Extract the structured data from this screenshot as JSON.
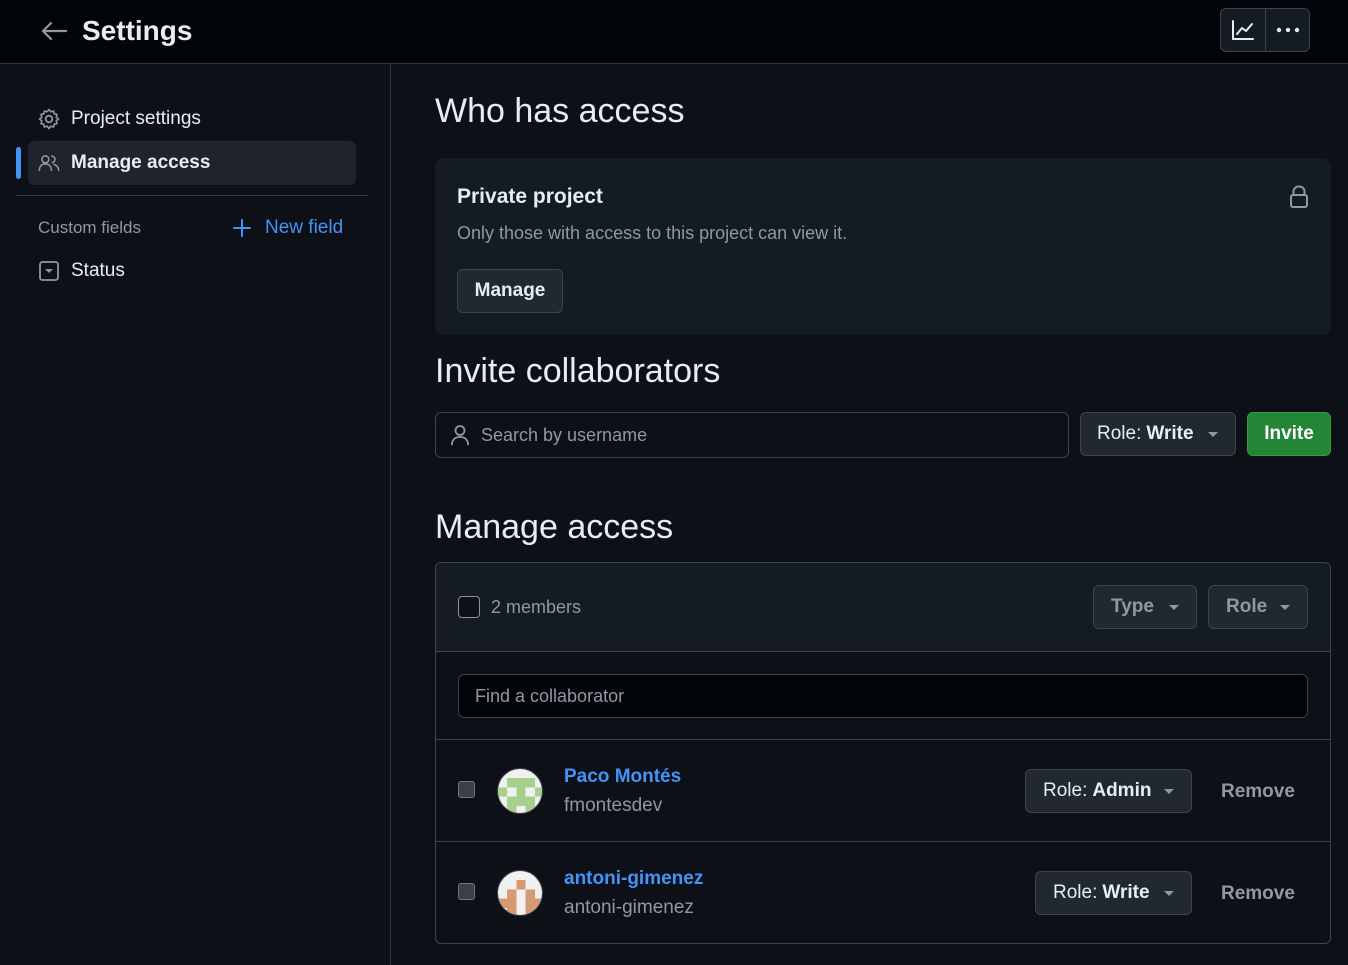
{
  "header": {
    "title": "Settings"
  },
  "sidebar": {
    "items": [
      {
        "label": "Project settings",
        "icon": "gear-icon"
      },
      {
        "label": "Manage access",
        "icon": "people-icon",
        "active": true
      }
    ],
    "custom_fields_label": "Custom fields",
    "new_field_label": "New field",
    "fields": [
      {
        "label": "Status",
        "icon": "single-select-icon"
      }
    ]
  },
  "who_has_access": {
    "heading": "Who has access",
    "card_title": "Private project",
    "card_description": "Only those with access to this project can view it.",
    "manage_label": "Manage"
  },
  "invite": {
    "heading": "Invite collaborators",
    "search_placeholder": "Search by username",
    "role_key": "Role:",
    "role_value": "Write",
    "invite_label": "Invite"
  },
  "manage_access": {
    "heading": "Manage access",
    "members_count": "2 members",
    "type_filter": "Type",
    "role_filter": "Role",
    "find_placeholder": "Find a collaborator",
    "members": [
      {
        "name": "Paco Montés",
        "login": "fmontesdev",
        "role_key": "Role:",
        "role_value": "Admin",
        "remove_label": "Remove"
      },
      {
        "name": "antoni-gimenez",
        "login": "antoni-gimenez",
        "role_key": "Role:",
        "role_value": "Write",
        "remove_label": "Remove"
      }
    ]
  },
  "colors": {
    "accent": "#4493f8",
    "invite_green": "#238636",
    "background": "#0d1117",
    "surface": "#151b23"
  }
}
